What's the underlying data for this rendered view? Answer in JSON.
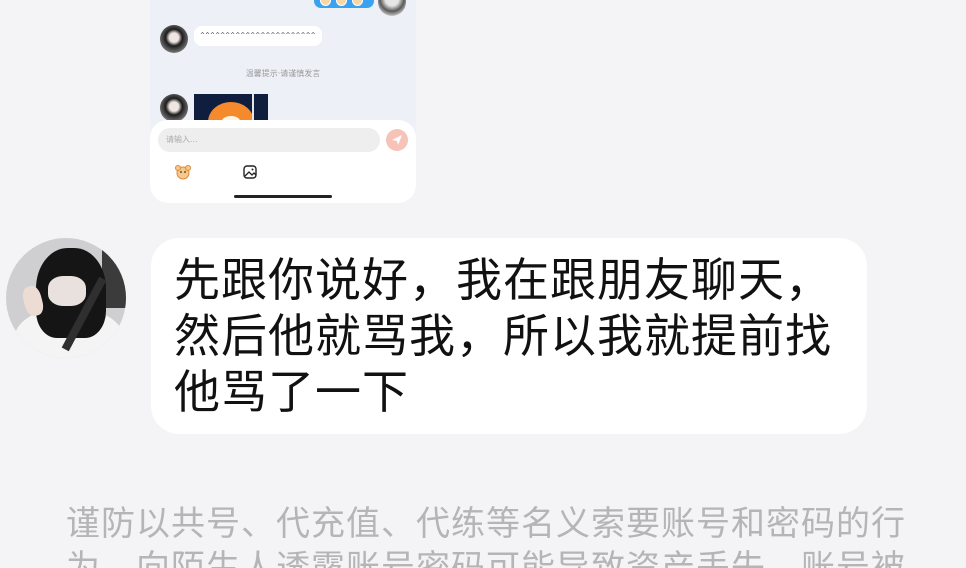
{
  "preview": {
    "message_text": "^^^^^^^^^^^^^^^^^^^^^^^",
    "notice": "温馨提示·请谨慎发言",
    "input_placeholder": "请输入..."
  },
  "main_message": {
    "text": "先跟你说好，我在跟朋友聊天，然后他就骂我，所以我就提前找他骂了一下"
  },
  "warning": {
    "text": "谨防以共号、代充值、代练等名义索要账号和密码的行为，向陌生人透露账号密码可能导致资产丢失，账号被"
  },
  "colors": {
    "page_bg": "#f4f4f6",
    "bubble_bg": "#ffffff",
    "accent_blue": "#3aa3f0",
    "send_button": "#f7c2b8",
    "warning_text": "#b5b5b8"
  },
  "icons": [
    "emoji-icon",
    "gallery-icon",
    "send-icon"
  ]
}
